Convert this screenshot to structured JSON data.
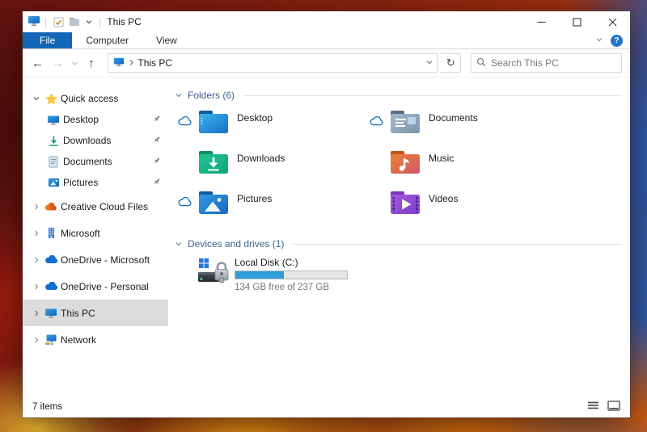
{
  "titlebar": {
    "title": "This PC",
    "qat": {
      "icons": [
        "properties-icon",
        "new-folder-icon",
        "customize-chevron"
      ]
    },
    "controls": [
      "minimize",
      "maximize",
      "close"
    ]
  },
  "ribbon": {
    "tabs": [
      {
        "label": "File",
        "active": true
      },
      {
        "label": "Computer",
        "active": false
      },
      {
        "label": "View",
        "active": false
      }
    ],
    "minimize_ribbon_icon": "chevron-down",
    "help_label": "?"
  },
  "navbar": {
    "address": {
      "root_label": "This PC"
    },
    "search": {
      "placeholder": "Search This PC"
    }
  },
  "sidebar": {
    "quick_access": {
      "label": "Quick access",
      "items": [
        {
          "label": "Desktop",
          "icon": "desktop-icon",
          "pinned": true
        },
        {
          "label": "Downloads",
          "icon": "downloads-icon",
          "pinned": true
        },
        {
          "label": "Documents",
          "icon": "documents-icon",
          "pinned": true
        },
        {
          "label": "Pictures",
          "icon": "pictures-icon",
          "pinned": true
        }
      ]
    },
    "roots": [
      {
        "label": "Creative Cloud Files",
        "icon": "creative-cloud-icon",
        "selected": false
      },
      {
        "label": "Microsoft",
        "icon": "building-icon",
        "selected": false
      },
      {
        "label": "OneDrive - Microsoft",
        "icon": "onedrive-cloud-icon",
        "selected": false
      },
      {
        "label": "OneDrive - Personal",
        "icon": "onedrive-cloud-icon",
        "selected": false
      },
      {
        "label": "This PC",
        "icon": "monitor-icon",
        "selected": true
      },
      {
        "label": "Network",
        "icon": "network-icon",
        "selected": false
      }
    ]
  },
  "main": {
    "folders_section": {
      "label": "Folders (6)",
      "tiles": [
        {
          "label": "Desktop",
          "icon": "desktop-folder",
          "onedrive_cloud": true
        },
        {
          "label": "Documents",
          "icon": "documents-folder",
          "onedrive_cloud": true
        },
        {
          "label": "Downloads",
          "icon": "downloads-folder",
          "onedrive_cloud": false
        },
        {
          "label": "Music",
          "icon": "music-folder",
          "onedrive_cloud": false
        },
        {
          "label": "Pictures",
          "icon": "pictures-folder",
          "onedrive_cloud": true
        },
        {
          "label": "Videos",
          "icon": "videos-folder",
          "onedrive_cloud": false
        }
      ]
    },
    "devices_section": {
      "label": "Devices and drives (1)",
      "drive": {
        "label": "Local Disk (C:)",
        "free_text": "134 GB free of 237 GB",
        "used_percent": 43.5,
        "icon": "bitlocker-drive-icon"
      }
    }
  },
  "statusbar": {
    "count": "7 items",
    "view_toggles": [
      "details-view-icon",
      "large-icons-view-icon"
    ]
  },
  "colors": {
    "file_tab_blue": "#1267b8",
    "group_header_blue": "#41618e",
    "disk_bar_fill": "#2f9fd8",
    "selection_gray": "#dcdcdc",
    "onedrive_blue": "#0c6cbe"
  }
}
